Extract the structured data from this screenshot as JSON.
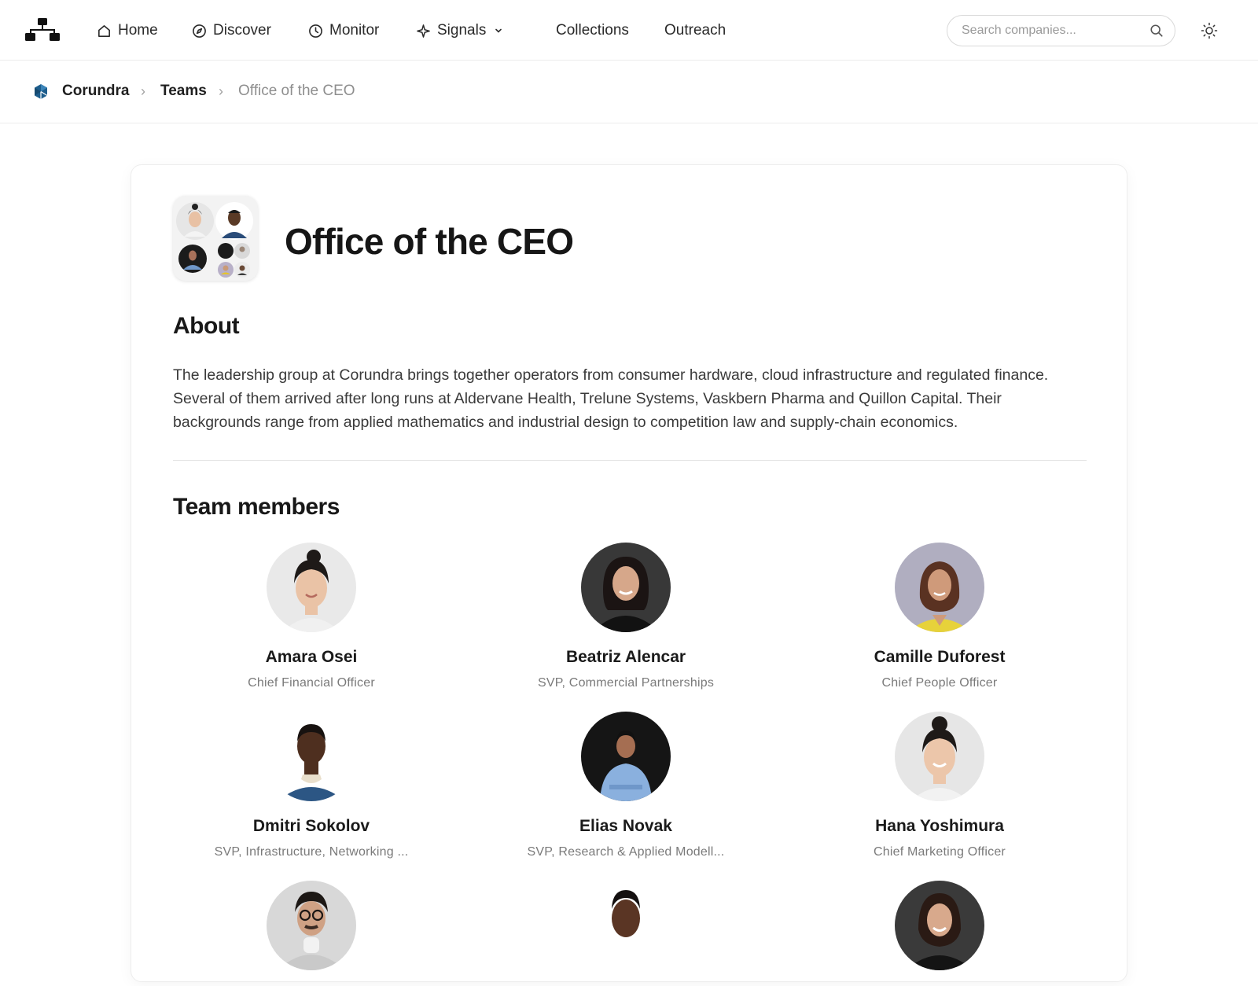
{
  "nav": {
    "items": [
      {
        "label": "Home",
        "icon": "home-icon"
      },
      {
        "label": "Discover",
        "icon": "compass-icon"
      },
      {
        "label": "Monitor",
        "icon": "clock-icon"
      },
      {
        "label": "Signals",
        "icon": "sparkle-icon",
        "has_dropdown": true
      },
      {
        "label": "Collections"
      },
      {
        "label": "Outreach"
      }
    ],
    "search_placeholder": "Search companies...",
    "theme_icon": "sun-icon"
  },
  "breadcrumb": {
    "company": "Corundra",
    "section": "Teams",
    "current": "Office of the CEO",
    "separator": "›"
  },
  "team": {
    "title": "Office of the CEO",
    "about_heading": "About",
    "about_text": "The leadership group at Corundra brings together operators from consumer hardware, cloud infrastructure and regulated finance. Several of them arrived after long runs at Aldervane Health, Trelune Systems, Vaskbern Pharma and Quillon Capital. Their backgrounds range from applied mathematics and industrial design to competition law and supply-chain economics.",
    "members_heading": "Team members",
    "members": [
      {
        "name": "Amara Osei",
        "role": "Chief Financial Officer"
      },
      {
        "name": "Beatriz Alencar",
        "role": "SVP, Commercial Partnerships"
      },
      {
        "name": "Camille Duforest",
        "role": "Chief People Officer"
      },
      {
        "name": "Dmitri Sokolov",
        "role": "SVP, Infrastructure, Networking ..."
      },
      {
        "name": "Elias Novak",
        "role": "SVP, Research & Applied Modell..."
      },
      {
        "name": "Hana Yoshimura",
        "role": "Chief Marketing Officer"
      },
      {
        "name": "",
        "role": ""
      },
      {
        "name": "",
        "role": ""
      },
      {
        "name": "",
        "role": ""
      }
    ]
  },
  "colors": {
    "accent_logo": "#1d5d8c",
    "text_primary": "#1b1b1b",
    "text_muted": "#7a7a7a",
    "border": "#ececec"
  }
}
